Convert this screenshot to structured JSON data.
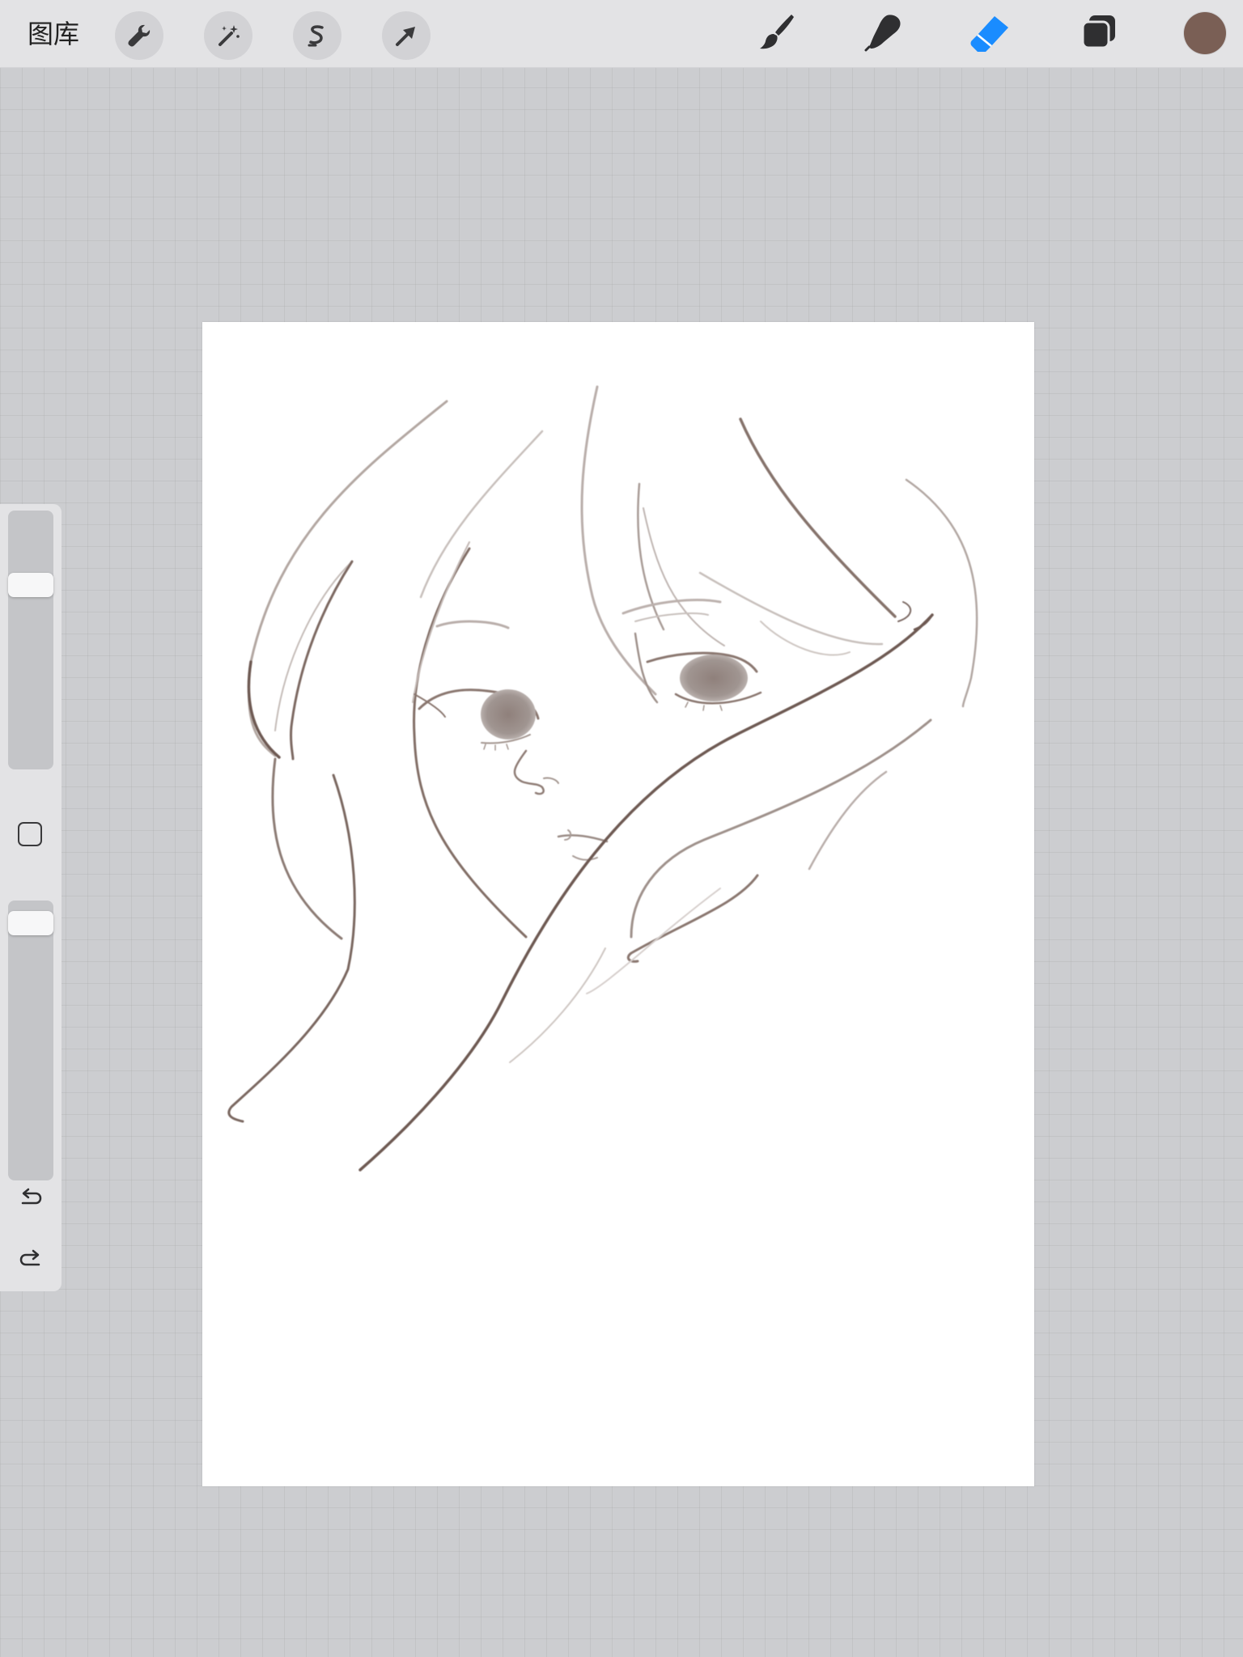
{
  "toolbar": {
    "gallery_label": "图库",
    "actions": [
      {
        "name": "adjust",
        "icon": "wrench-icon"
      },
      {
        "name": "adjustments",
        "icon": "magic-wand-icon"
      },
      {
        "name": "selection",
        "icon": "selection-s-icon"
      },
      {
        "name": "transform",
        "icon": "arrow-cursor-icon"
      }
    ],
    "tools": [
      {
        "name": "brush",
        "icon": "paintbrush-icon",
        "active": false
      },
      {
        "name": "smudge",
        "icon": "smudge-finger-icon",
        "active": false
      },
      {
        "name": "eraser",
        "icon": "eraser-icon",
        "active": true
      },
      {
        "name": "layers",
        "icon": "layers-icon",
        "active": false
      }
    ],
    "current_color": "#7a5f55",
    "active_tool_color": "#1a8cff"
  },
  "sidebar": {
    "brush_size_level": 0.74,
    "opacity_level": 0.97,
    "modify_button_icon": "square-icon",
    "undo_icon": "undo-icon",
    "redo_icon": "redo-icon"
  },
  "canvas": {
    "background": "#ffffff",
    "stroke_color": "#6e5a52",
    "content": "line-sketch-girl-face"
  }
}
